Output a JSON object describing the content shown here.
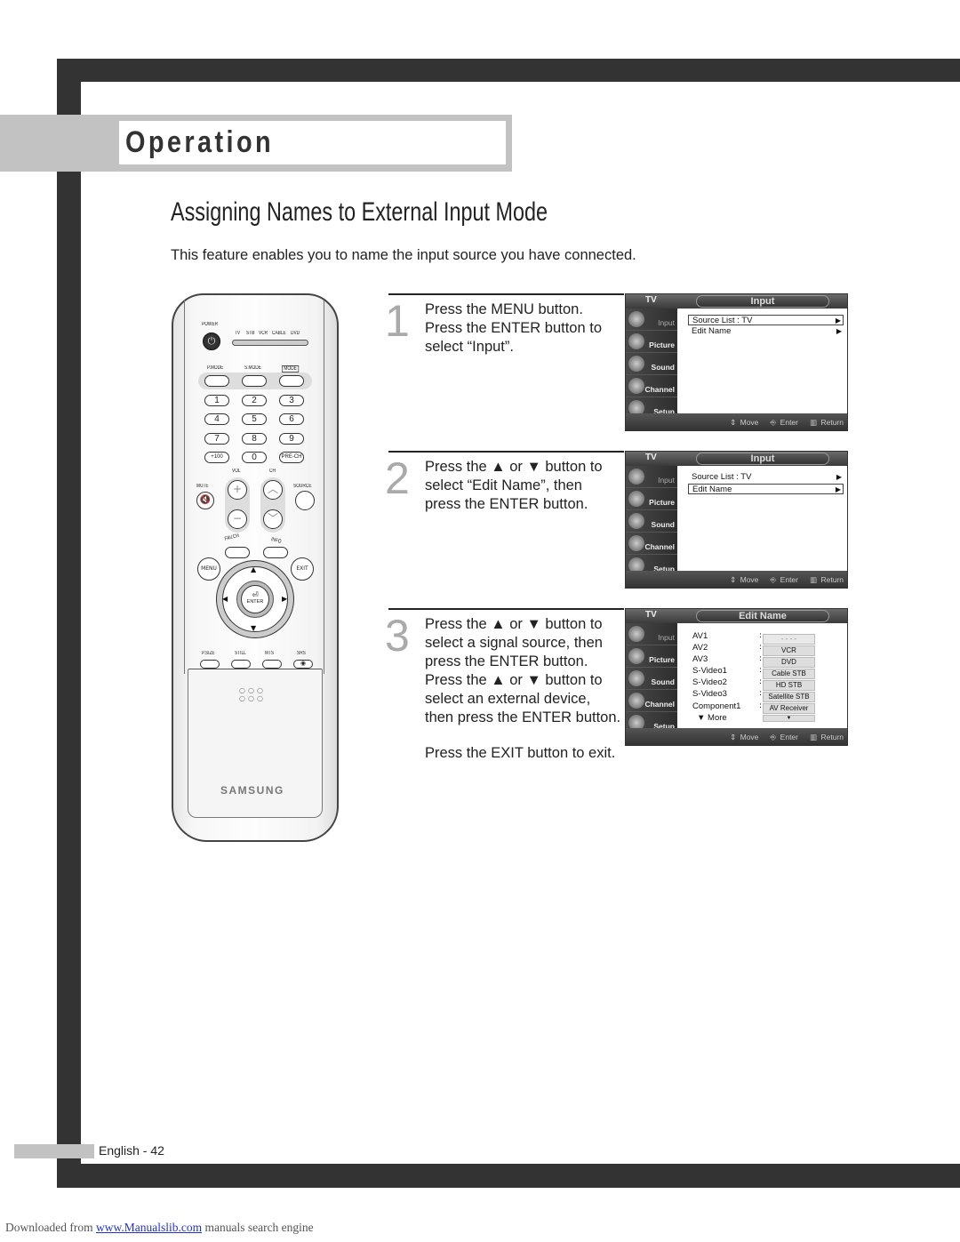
{
  "section": {
    "title": "Operation"
  },
  "page": {
    "title": "Assigning Names to External Input Mode",
    "intro": "This feature enables you to name the input source you have connected."
  },
  "remote": {
    "power_label": "POWER",
    "devices": [
      "TV",
      "STB",
      "VCR",
      "CABLE",
      "DVD"
    ],
    "mode_labels": [
      "P.MODE",
      "S.MODE",
      "MODE"
    ],
    "numbers": [
      "1",
      "2",
      "3",
      "4",
      "5",
      "6",
      "7",
      "8",
      "9",
      "+100",
      "0",
      "PRE-CH"
    ],
    "vol_label": "VOL",
    "ch_label": "CH",
    "mute_label": "MUTE",
    "source_label": "SOURCE",
    "fav_label": "FAV.CH",
    "info_label": "INFO",
    "menu_label": "MENU",
    "exit_label": "EXIT",
    "enter_label": "ENTER",
    "bottom_labels": [
      "P.SIZE",
      "STILL",
      "MTS",
      "SRS"
    ],
    "brand": "SAMSUNG"
  },
  "steps": [
    {
      "number": "1",
      "lines": [
        "Press the MENU button.",
        "Press the ENTER button to",
        "select “Input”."
      ]
    },
    {
      "number": "2",
      "lines": [
        "Press the ▲ or ▼ button to",
        "select “Edit Name”, then",
        "press the ENTER button."
      ]
    },
    {
      "number": "3",
      "lines": [
        "Press the ▲ or ▼ button to",
        "select a signal source, then",
        "press the ENTER button.",
        "Press the ▲ or ▼ button to",
        "select an external device,",
        "then press the ENTER button."
      ]
    }
  ],
  "exit_note": "Press the EXIT button to exit.",
  "osd": {
    "tv_label": "TV",
    "sidebar": [
      "Input",
      "Picture",
      "Sound",
      "Channel",
      "Setup"
    ],
    "footer": {
      "move": "Move",
      "enter": "Enter",
      "return": "Return"
    },
    "screens": [
      {
        "title": "Input",
        "rows": [
          {
            "label": "Source List   : TV",
            "arrow": "▶",
            "selected": true
          },
          {
            "label": "Edit Name",
            "arrow": "▶",
            "selected": false
          }
        ]
      },
      {
        "title": "Input",
        "rows": [
          {
            "label": "Source List   : TV",
            "arrow": "▶",
            "selected": false
          },
          {
            "label": "Edit Name",
            "arrow": "▶",
            "selected": true
          }
        ]
      },
      {
        "title": "Edit Name",
        "sources": [
          "AV1",
          "AV2",
          "AV3",
          "S-Video1",
          "S-Video2",
          "S-Video3",
          "Component1",
          "▼ More"
        ],
        "options": [
          "- - - -",
          "VCR",
          "DVD",
          "Cable STB",
          "HD STB",
          "Satellite STB",
          "AV Receiver",
          "▼"
        ]
      }
    ]
  },
  "footer": {
    "page_label": "English - 42",
    "downloaded_prefix": "Downloaded from ",
    "downloaded_link": "www.Manualslib.com",
    "downloaded_suffix": " manuals search engine"
  }
}
